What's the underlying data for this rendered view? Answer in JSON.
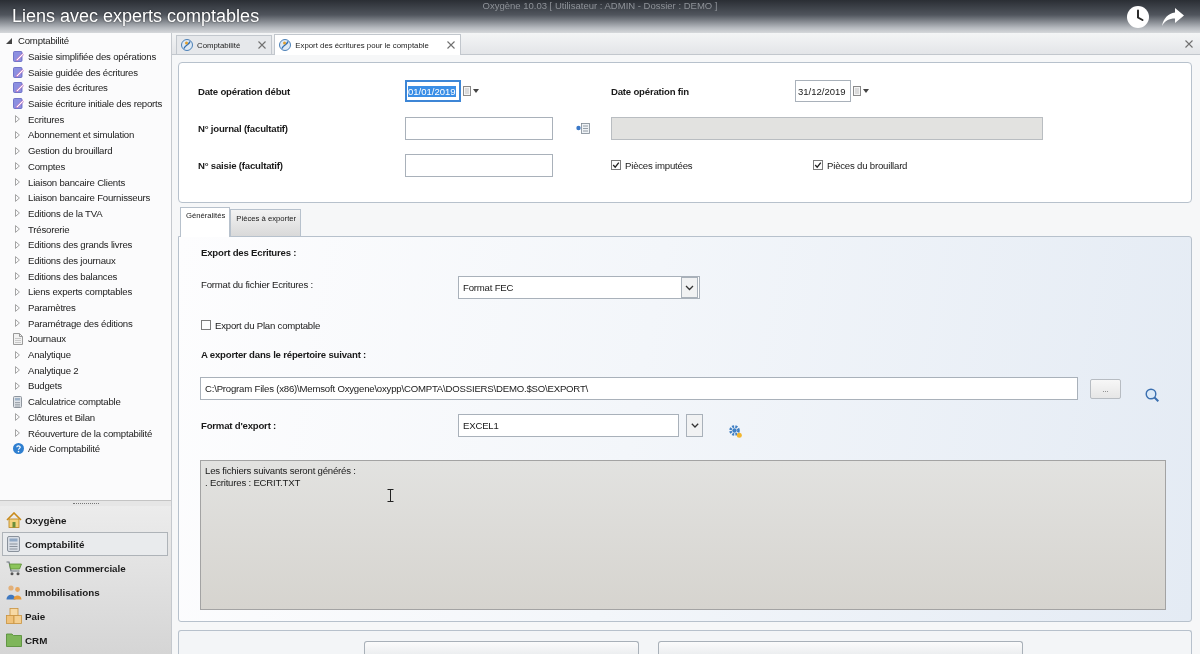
{
  "video_overlay": {
    "title": "Liens avec experts comptables"
  },
  "window": {
    "title": "Oxygène 10.03 [ Utilisateur : ADMIN - Dossier : DEMO ]"
  },
  "document_tabs": [
    {
      "label": "Comptabilité",
      "selected": false
    },
    {
      "label": "Export des écritures pour le comptable",
      "selected": true
    }
  ],
  "sidebar": {
    "tree": {
      "label": "Comptabilité",
      "expanded": true,
      "children": [
        {
          "label": "Saisie simplifiée des opérations",
          "kind": "form"
        },
        {
          "label": "Saisie guidée des écritures",
          "kind": "form"
        },
        {
          "label": "Saisie des écritures",
          "kind": "form"
        },
        {
          "label": "Saisie écriture initiale des reports",
          "kind": "form"
        },
        {
          "label": "Ecritures",
          "kind": "folder",
          "expanded": false
        },
        {
          "label": "Abonnement et simulation",
          "kind": "folder",
          "expanded": false
        },
        {
          "label": "Gestion du brouillard",
          "kind": "folder",
          "expanded": false
        },
        {
          "label": "Comptes",
          "kind": "folder",
          "expanded": false
        },
        {
          "label": "Liaison bancaire Clients",
          "kind": "folder",
          "expanded": false
        },
        {
          "label": "Liaison bancaire Fournisseurs",
          "kind": "folder",
          "expanded": false
        },
        {
          "label": "Editions de la TVA",
          "kind": "folder",
          "expanded": false
        },
        {
          "label": "Trésorerie",
          "kind": "folder",
          "expanded": false
        },
        {
          "label": "Editions des grands livres",
          "kind": "folder",
          "expanded": false
        },
        {
          "label": "Editions des journaux",
          "kind": "folder",
          "expanded": false
        },
        {
          "label": "Editions des balances",
          "kind": "folder",
          "expanded": false
        },
        {
          "label": "Liens experts comptables",
          "kind": "folder",
          "expanded": false
        },
        {
          "label": "Paramètres",
          "kind": "folder",
          "expanded": false
        },
        {
          "label": "Paramétrage des éditions",
          "kind": "folder",
          "expanded": false
        },
        {
          "label": "Journaux",
          "kind": "document"
        },
        {
          "label": "Analytique",
          "kind": "folder",
          "expanded": false
        },
        {
          "label": "Analytique 2",
          "kind": "folder",
          "expanded": false
        },
        {
          "label": "Budgets",
          "kind": "folder",
          "expanded": false
        },
        {
          "label": "Calculatrice comptable",
          "kind": "calculator"
        },
        {
          "label": "Clôtures et Bilan",
          "kind": "folder",
          "expanded": false
        },
        {
          "label": "Réouverture de la comptabilité",
          "kind": "folder",
          "expanded": false
        },
        {
          "label": "Aide Comptabilité",
          "kind": "help"
        }
      ]
    },
    "modules": [
      {
        "label": "Oxygène",
        "selected": false
      },
      {
        "label": "Comptabilité",
        "selected": true
      },
      {
        "label": "Gestion Commerciale",
        "selected": false
      },
      {
        "label": "Immobilisations",
        "selected": false
      },
      {
        "label": "Paie",
        "selected": false
      },
      {
        "label": "CRM",
        "selected": false
      }
    ]
  },
  "filters": {
    "date_start": {
      "label": "Date opération début",
      "value": "01/01/2019",
      "highlighted": true
    },
    "date_end": {
      "label": "Date opération fin",
      "value": "31/12/2019",
      "highlighted": false
    },
    "journal": {
      "label": "N° journal (facultatif)"
    },
    "journal_name": {
      "disabled": true
    },
    "entry": {
      "label": "N° saisie (facultatif)"
    },
    "options": [
      {
        "label": "Pièces imputées",
        "checked": true
      },
      {
        "label": "Pièces du brouillard",
        "checked": true
      }
    ]
  },
  "tabs": [
    {
      "label": "Généralités",
      "selected": true
    },
    {
      "label": "Pièces à exporter",
      "selected": false
    }
  ],
  "export": {
    "heading": "Export des Ecritures :",
    "file_format": {
      "label": "Format du fichier Ecritures :",
      "value": "Format FEC"
    },
    "chart_of_accounts": {
      "label": "Export du Plan comptable",
      "checked": false
    },
    "directory_label": "A exporter dans le répertoire suivant :",
    "directory": {
      "value": "C:\\Program Files (x86)\\Memsoft Oxygene\\oxypp\\COMPTA\\DOSSIERS\\DEMO.$SO\\EXPORT\\"
    },
    "browse_button": "...",
    "export_format": {
      "label": "Format d'export :",
      "value": "EXCEL1"
    },
    "generated_files": [
      "Les fichiers suivants seront générés :",
      ". Ecritures : ECRIT.TXT"
    ]
  }
}
